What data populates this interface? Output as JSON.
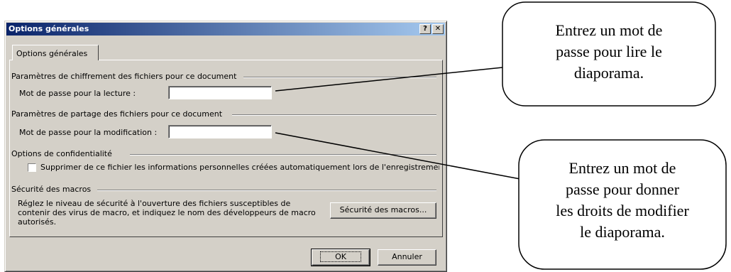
{
  "dialog": {
    "title": "Options générales",
    "help_button": "?",
    "close_button": "✕",
    "tab_label": "Options générales",
    "encryption": {
      "group_label": "Paramètres de chiffrement des fichiers pour ce document",
      "password_label": "Mot de passe pour la lecture :",
      "password_value": ""
    },
    "sharing": {
      "group_label": "Paramètres de partage des fichiers pour ce document",
      "password_label": "Mot de passe pour la modification :",
      "password_value": ""
    },
    "privacy": {
      "group_label": "Options de confidentialité",
      "checkbox_label": "Supprimer de ce fichier les informations personnelles créées automatiquement lors de l'enregistrement",
      "checked": false
    },
    "macros": {
      "group_label": "Sécurité des macros",
      "description": "Réglez le niveau de sécurité à l'ouverture des fichiers susceptibles de contenir des virus de macro, et indiquez le nom des développeurs de macro autorisés.",
      "button_label": "Sécurité des macros..."
    },
    "ok_label": "OK",
    "cancel_label": "Annuler"
  },
  "callouts": {
    "read": {
      "line1": "Entrez un mot de",
      "line2": "passe pour lire le",
      "line3": "diaporama."
    },
    "modify": {
      "line1": "Entrez un mot de",
      "line2": "passe pour donner",
      "line3": "les droits de modifier",
      "line4": "le diaporama."
    }
  }
}
